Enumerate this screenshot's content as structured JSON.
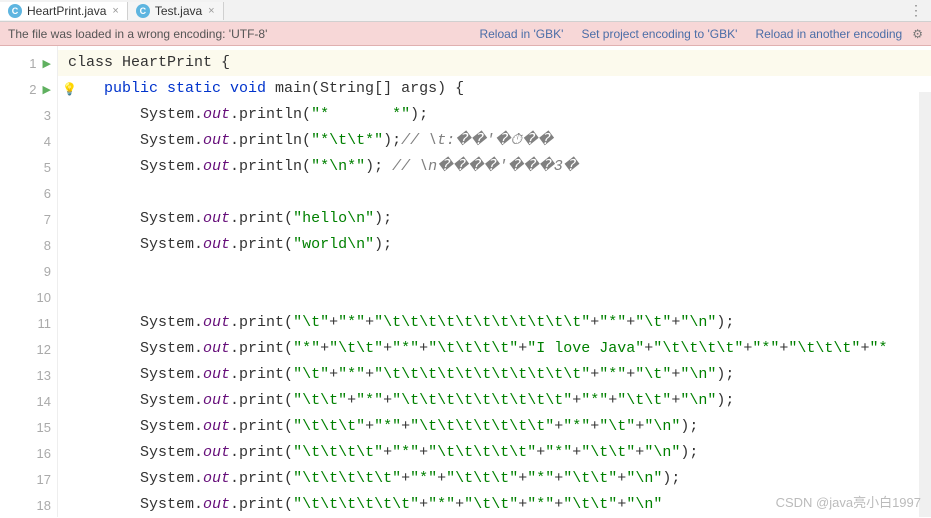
{
  "tabs": [
    {
      "icon": "C",
      "label": "HeartPrint.java",
      "active": true
    },
    {
      "icon": "C",
      "label": "Test.java",
      "active": false
    }
  ],
  "more_icon": "⋮",
  "banner": {
    "message": "The file was loaded in a wrong encoding: 'UTF-8'",
    "link1": "Reload in 'GBK'",
    "link2": "Set project encoding to 'GBK'",
    "link3": "Reload in another encoding",
    "gear": "⚙"
  },
  "checkmark": "✔",
  "lines": [
    {
      "n": "1",
      "run": true,
      "hl": true,
      "tokens": [
        [
          "p",
          "class "
        ],
        [
          "p",
          "HeartPrint {"
        ]
      ]
    },
    {
      "n": "2",
      "run": true,
      "bulb": true,
      "tokens": [
        [
          "p",
          "    "
        ],
        [
          "kb",
          "public static void "
        ],
        [
          "p",
          "main(String[] args) {"
        ]
      ]
    },
    {
      "n": "3",
      "tokens": [
        [
          "p",
          "        System."
        ],
        [
          "fld",
          "out"
        ],
        [
          "p",
          ".println("
        ],
        [
          "str",
          "\"*       *\""
        ],
        [
          "p",
          ");"
        ]
      ]
    },
    {
      "n": "4",
      "tokens": [
        [
          "p",
          "        System."
        ],
        [
          "fld",
          "out"
        ],
        [
          "p",
          ".println("
        ],
        [
          "str",
          "\"*"
        ],
        [
          "esc",
          "\\t\\t"
        ],
        [
          "str",
          "*\""
        ],
        [
          "p",
          ");"
        ],
        [
          "cmt",
          "// \\t:��'�⏱��"
        ]
      ]
    },
    {
      "n": "5",
      "tokens": [
        [
          "p",
          "        System."
        ],
        [
          "fld",
          "out"
        ],
        [
          "p",
          ".println("
        ],
        [
          "str",
          "\"*"
        ],
        [
          "esc",
          "\\n"
        ],
        [
          "str",
          "*\""
        ],
        [
          "p",
          "); "
        ],
        [
          "cmt",
          "// \\n����'���3�"
        ]
      ]
    },
    {
      "n": "6",
      "tokens": [
        [
          "p",
          ""
        ]
      ]
    },
    {
      "n": "7",
      "tokens": [
        [
          "p",
          "        System."
        ],
        [
          "fld",
          "out"
        ],
        [
          "p",
          ".print("
        ],
        [
          "str",
          "\"hello"
        ],
        [
          "esc",
          "\\n"
        ],
        [
          "str",
          "\""
        ],
        [
          "p",
          ");"
        ]
      ]
    },
    {
      "n": "8",
      "tokens": [
        [
          "p",
          "        System."
        ],
        [
          "fld",
          "out"
        ],
        [
          "p",
          ".print("
        ],
        [
          "str",
          "\"world"
        ],
        [
          "esc",
          "\\n"
        ],
        [
          "str",
          "\""
        ],
        [
          "p",
          ");"
        ]
      ]
    },
    {
      "n": "9",
      "tokens": [
        [
          "p",
          ""
        ]
      ]
    },
    {
      "n": "10",
      "tokens": [
        [
          "p",
          ""
        ]
      ]
    },
    {
      "n": "11",
      "tokens": [
        [
          "p",
          "        System."
        ],
        [
          "fld",
          "out"
        ],
        [
          "p",
          ".print("
        ],
        [
          "str",
          "\""
        ],
        [
          "esc",
          "\\t"
        ],
        [
          "str",
          "\""
        ],
        [
          "p",
          "+"
        ],
        [
          "str",
          "\"*\""
        ],
        [
          "p",
          "+"
        ],
        [
          "str",
          "\""
        ],
        [
          "esc",
          "\\t\\t\\t\\t\\t\\t\\t\\t\\t\\t\\t"
        ],
        [
          "str",
          "\""
        ],
        [
          "p",
          "+"
        ],
        [
          "str",
          "\"*\""
        ],
        [
          "p",
          "+"
        ],
        [
          "str",
          "\""
        ],
        [
          "esc",
          "\\t"
        ],
        [
          "str",
          "\""
        ],
        [
          "p",
          "+"
        ],
        [
          "str",
          "\""
        ],
        [
          "esc",
          "\\n"
        ],
        [
          "str",
          "\""
        ],
        [
          "p",
          ");"
        ]
      ]
    },
    {
      "n": "12",
      "tokens": [
        [
          "p",
          "        System."
        ],
        [
          "fld",
          "out"
        ],
        [
          "p",
          ".print("
        ],
        [
          "str",
          "\"*\""
        ],
        [
          "p",
          "+"
        ],
        [
          "str",
          "\""
        ],
        [
          "esc",
          "\\t\\t"
        ],
        [
          "str",
          "\""
        ],
        [
          "p",
          "+"
        ],
        [
          "str",
          "\"*\""
        ],
        [
          "p",
          "+"
        ],
        [
          "str",
          "\""
        ],
        [
          "esc",
          "\\t\\t\\t\\t"
        ],
        [
          "str",
          "\""
        ],
        [
          "p",
          "+"
        ],
        [
          "str",
          "\"I love Java\""
        ],
        [
          "p",
          "+"
        ],
        [
          "str",
          "\""
        ],
        [
          "esc",
          "\\t\\t\\t\\t"
        ],
        [
          "str",
          "\""
        ],
        [
          "p",
          "+"
        ],
        [
          "str",
          "\"*\""
        ],
        [
          "p",
          "+"
        ],
        [
          "str",
          "\""
        ],
        [
          "esc",
          "\\t\\t\\t"
        ],
        [
          "str",
          "\""
        ],
        [
          "p",
          "+"
        ],
        [
          "str",
          "\"*"
        ]
      ]
    },
    {
      "n": "13",
      "tokens": [
        [
          "p",
          "        System."
        ],
        [
          "fld",
          "out"
        ],
        [
          "p",
          ".print("
        ],
        [
          "str",
          "\""
        ],
        [
          "esc",
          "\\t"
        ],
        [
          "str",
          "\""
        ],
        [
          "p",
          "+"
        ],
        [
          "str",
          "\"*\""
        ],
        [
          "p",
          "+"
        ],
        [
          "str",
          "\""
        ],
        [
          "esc",
          "\\t\\t\\t\\t\\t\\t\\t\\t\\t\\t\\t"
        ],
        [
          "str",
          "\""
        ],
        [
          "p",
          "+"
        ],
        [
          "str",
          "\"*\""
        ],
        [
          "p",
          "+"
        ],
        [
          "str",
          "\""
        ],
        [
          "esc",
          "\\t"
        ],
        [
          "str",
          "\""
        ],
        [
          "p",
          "+"
        ],
        [
          "str",
          "\""
        ],
        [
          "esc",
          "\\n"
        ],
        [
          "str",
          "\""
        ],
        [
          "p",
          ");"
        ]
      ]
    },
    {
      "n": "14",
      "tokens": [
        [
          "p",
          "        System."
        ],
        [
          "fld",
          "out"
        ],
        [
          "p",
          ".print("
        ],
        [
          "str",
          "\""
        ],
        [
          "esc",
          "\\t\\t"
        ],
        [
          "str",
          "\""
        ],
        [
          "p",
          "+"
        ],
        [
          "str",
          "\"*\""
        ],
        [
          "p",
          "+"
        ],
        [
          "str",
          "\""
        ],
        [
          "esc",
          "\\t\\t\\t\\t\\t\\t\\t\\t\\t"
        ],
        [
          "str",
          "\""
        ],
        [
          "p",
          "+"
        ],
        [
          "str",
          "\"*\""
        ],
        [
          "p",
          "+"
        ],
        [
          "str",
          "\""
        ],
        [
          "esc",
          "\\t\\t"
        ],
        [
          "str",
          "\""
        ],
        [
          "p",
          "+"
        ],
        [
          "str",
          "\""
        ],
        [
          "esc",
          "\\n"
        ],
        [
          "str",
          "\""
        ],
        [
          "p",
          ");"
        ]
      ]
    },
    {
      "n": "15",
      "tokens": [
        [
          "p",
          "        System."
        ],
        [
          "fld",
          "out"
        ],
        [
          "p",
          ".print("
        ],
        [
          "str",
          "\""
        ],
        [
          "esc",
          "\\t\\t\\t"
        ],
        [
          "str",
          "\""
        ],
        [
          "p",
          "+"
        ],
        [
          "str",
          "\"*\""
        ],
        [
          "p",
          "+"
        ],
        [
          "str",
          "\""
        ],
        [
          "esc",
          "\\t\\t\\t\\t\\t\\t\\t"
        ],
        [
          "str",
          "\""
        ],
        [
          "p",
          "+"
        ],
        [
          "str",
          "\"*\""
        ],
        [
          "p",
          "+"
        ],
        [
          "str",
          "\""
        ],
        [
          "esc",
          "\\t"
        ],
        [
          "str",
          "\""
        ],
        [
          "p",
          "+"
        ],
        [
          "str",
          "\""
        ],
        [
          "esc",
          "\\n"
        ],
        [
          "str",
          "\""
        ],
        [
          "p",
          ");"
        ]
      ]
    },
    {
      "n": "16",
      "tokens": [
        [
          "p",
          "        System."
        ],
        [
          "fld",
          "out"
        ],
        [
          "p",
          ".print("
        ],
        [
          "str",
          "\""
        ],
        [
          "esc",
          "\\t\\t\\t\\t"
        ],
        [
          "str",
          "\""
        ],
        [
          "p",
          "+"
        ],
        [
          "str",
          "\"*\""
        ],
        [
          "p",
          "+"
        ],
        [
          "str",
          "\""
        ],
        [
          "esc",
          "\\t\\t\\t\\t\\t"
        ],
        [
          "str",
          "\""
        ],
        [
          "p",
          "+"
        ],
        [
          "str",
          "\"*\""
        ],
        [
          "p",
          "+"
        ],
        [
          "str",
          "\""
        ],
        [
          "esc",
          "\\t\\t"
        ],
        [
          "str",
          "\""
        ],
        [
          "p",
          "+"
        ],
        [
          "str",
          "\""
        ],
        [
          "esc",
          "\\n"
        ],
        [
          "str",
          "\""
        ],
        [
          "p",
          ");"
        ]
      ]
    },
    {
      "n": "17",
      "tokens": [
        [
          "p",
          "        System."
        ],
        [
          "fld",
          "out"
        ],
        [
          "p",
          ".print("
        ],
        [
          "str",
          "\""
        ],
        [
          "esc",
          "\\t\\t\\t\\t\\t"
        ],
        [
          "str",
          "\""
        ],
        [
          "p",
          "+"
        ],
        [
          "str",
          "\"*\""
        ],
        [
          "p",
          "+"
        ],
        [
          "str",
          "\""
        ],
        [
          "esc",
          "\\t\\t\\t"
        ],
        [
          "str",
          "\""
        ],
        [
          "p",
          "+"
        ],
        [
          "str",
          "\"*\""
        ],
        [
          "p",
          "+"
        ],
        [
          "str",
          "\""
        ],
        [
          "esc",
          "\\t\\t"
        ],
        [
          "str",
          "\""
        ],
        [
          "p",
          "+"
        ],
        [
          "str",
          "\""
        ],
        [
          "esc",
          "\\n"
        ],
        [
          "str",
          "\""
        ],
        [
          "p",
          ");"
        ]
      ]
    },
    {
      "n": "18",
      "tokens": [
        [
          "p",
          "        System."
        ],
        [
          "fld",
          "out"
        ],
        [
          "p",
          ".print("
        ],
        [
          "str",
          "\""
        ],
        [
          "esc",
          "\\t\\t\\t\\t\\t\\t"
        ],
        [
          "str",
          "\""
        ],
        [
          "p",
          "+"
        ],
        [
          "str",
          "\"*\""
        ],
        [
          "p",
          "+"
        ],
        [
          "str",
          "\""
        ],
        [
          "esc",
          "\\t\\t"
        ],
        [
          "str",
          "\""
        ],
        [
          "p",
          "+"
        ],
        [
          "str",
          "\"*\""
        ],
        [
          "p",
          "+"
        ],
        [
          "str",
          "\""
        ],
        [
          "esc",
          "\\t\\t"
        ],
        [
          "str",
          "\""
        ],
        [
          "p",
          "+"
        ],
        [
          "str",
          "\""
        ],
        [
          "esc",
          "\\n"
        ],
        [
          "str",
          "\""
        ]
      ]
    }
  ],
  "watermark": "CSDN @java亮小白1997"
}
